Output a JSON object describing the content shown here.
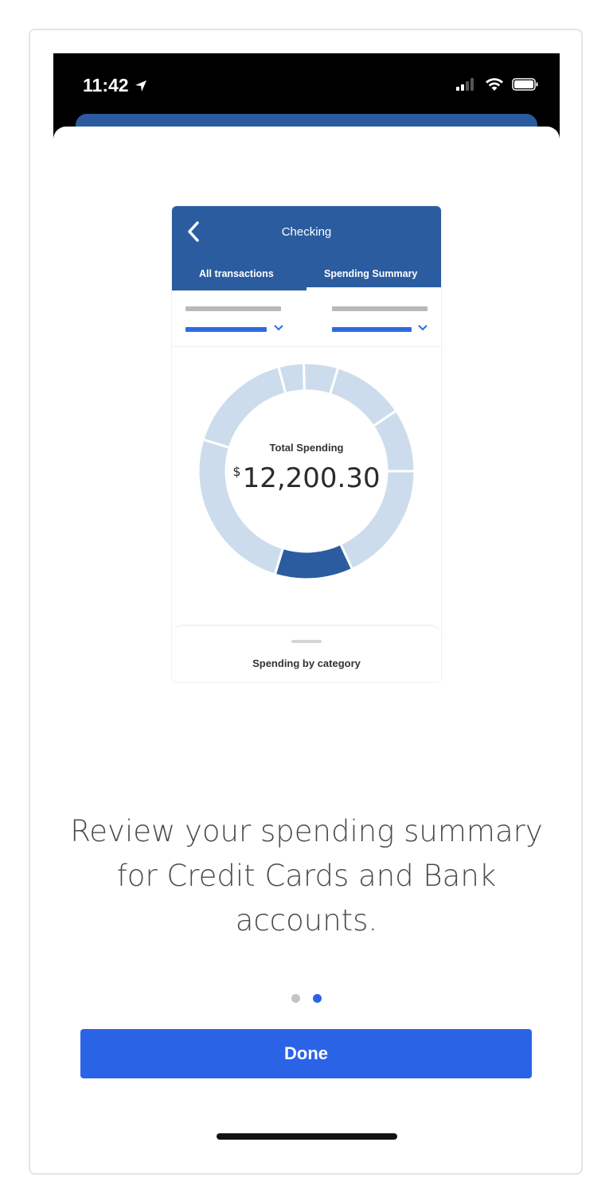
{
  "status_bar": {
    "time": "11:42",
    "icons": [
      "location-arrow-icon",
      "signal-icon",
      "wifi-icon",
      "battery-icon"
    ]
  },
  "preview": {
    "title": "Checking",
    "tabs": [
      {
        "label": "All transactions",
        "active": false
      },
      {
        "label": "Spending Summary",
        "active": true
      }
    ],
    "total_label": "Total Spending",
    "currency_symbol": "$",
    "total_value": "12,200.30",
    "bottom_sheet_label": "Spending by category"
  },
  "caption": "Review your spending summary for Credit Cards and Bank accounts.",
  "pagination": {
    "count": 2,
    "active_index": 1
  },
  "primary_button": {
    "label": "Done"
  },
  "colors": {
    "brand_blue": "#2b5ca0",
    "button_blue": "#2a63e6",
    "donut_light": "#cddcec",
    "donut_dark": "#2b5ca0",
    "dot_inactive": "#c4c4c4",
    "dot_active": "#2a63e6"
  }
}
